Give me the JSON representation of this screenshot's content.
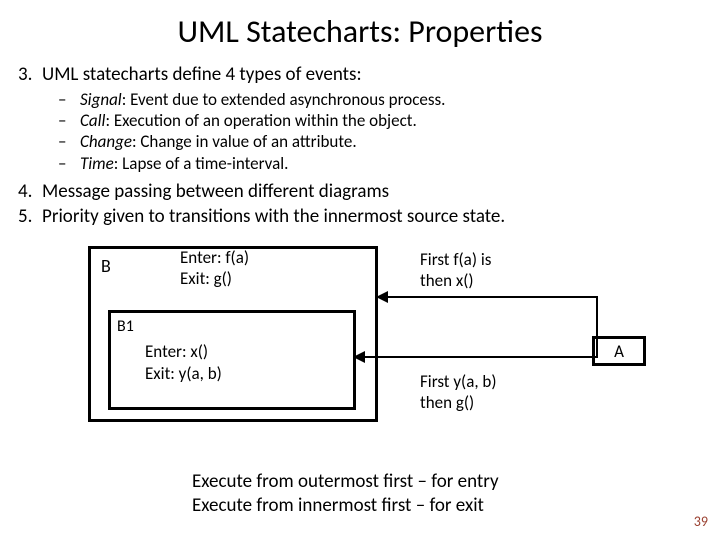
{
  "title": "UML Statecharts: Properties",
  "list": {
    "item3_num": "3.",
    "item3_text": "UML statecharts define 4 types of events:",
    "sub": {
      "s1_em": "Signal",
      "s1_rest": ": Event due to extended asynchronous process.",
      "s2_em": "Call",
      "s2_rest": ": Execution of an operation within the object.",
      "s3_em": "Change",
      "s3_rest": ": Change in value of an attribute.",
      "s4_em": "Time",
      "s4_rest": ": Lapse of a time-interval."
    },
    "item4_num": "4.",
    "item4_text": "Message passing between different diagrams",
    "item5_num": "5.",
    "item5_text": "Priority given to transitions with the innermost source state."
  },
  "diagram": {
    "B_label": "B",
    "B_enter": "Enter: f(a)",
    "B_exit": "Exit: g()",
    "B1_label": "B1",
    "B1_enter": "Enter: x()",
    "B1_exit": "Exit: y(a, b)",
    "A_label": "A",
    "note1_l1": "First f(a) is",
    "note1_l2": "then x()",
    "note2_l1": "First y(a, b)",
    "note2_l2": "then g()"
  },
  "conclusion": {
    "l1": "Execute from outermost first – for entry",
    "l2": "Execute from innermost first – for exit"
  },
  "page_number": "39"
}
